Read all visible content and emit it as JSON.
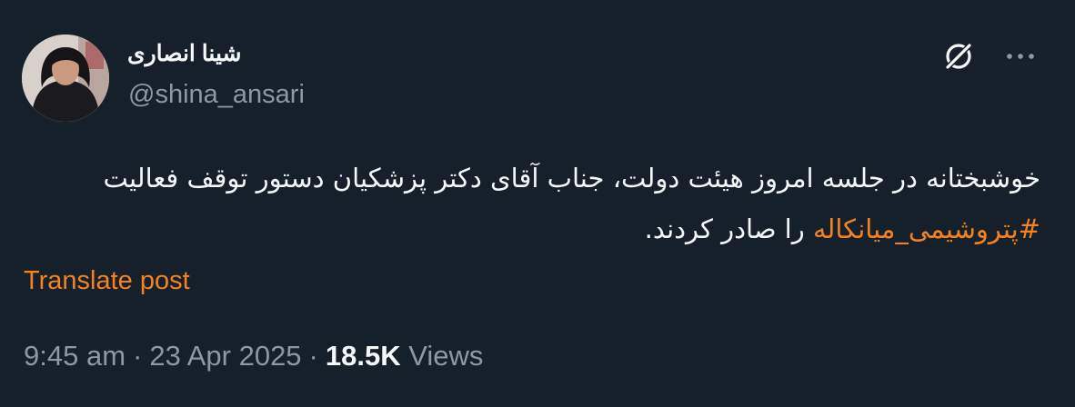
{
  "author": {
    "display_name": "شینا انصاری",
    "handle": "@shina_ansari"
  },
  "icons": {
    "grok": "grok-icon",
    "more": "more-icon",
    "avatar": "profile-photo"
  },
  "post": {
    "line1": "خوشبختانه در جلسه امروز هیئت دولت، جناب آقای دکتر پزشکیان دستور توقف فعالیت",
    "hashtag": "#پتروشیمی_میانکاله",
    "line2_rest": " را صادر کردند."
  },
  "translate_label": "Translate post",
  "meta": {
    "time": "9:45 am",
    "separator": "·",
    "date": "23 Apr 2025",
    "views_count": "18.5K",
    "views_label": "Views"
  },
  "colors": {
    "background": "#15202b",
    "text": "#f7f9f9",
    "secondary": "#8b98a5",
    "accent": "#f4821f"
  }
}
